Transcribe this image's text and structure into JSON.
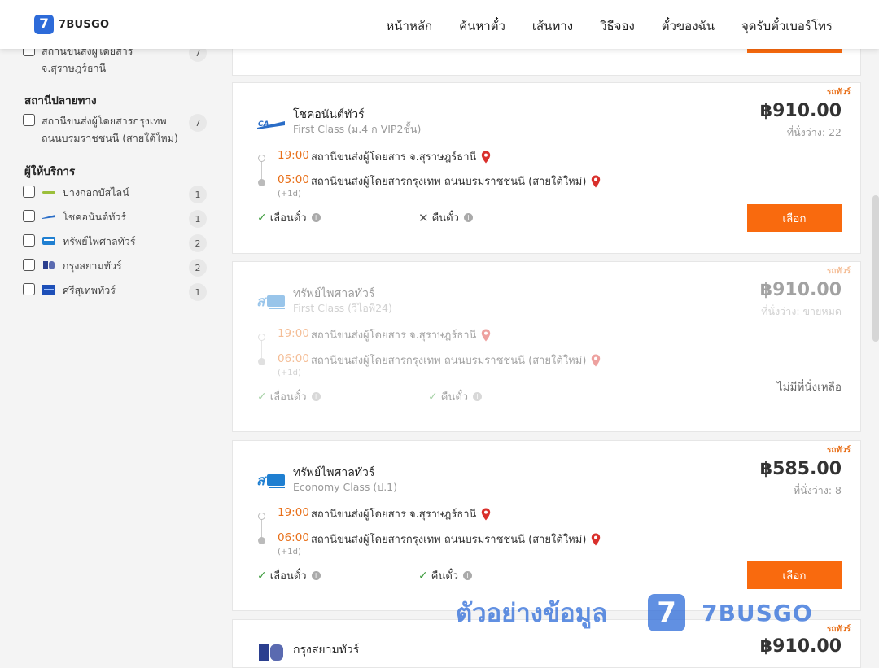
{
  "header": {
    "logo_mark": "7",
    "logo_text": "7BUSGO",
    "nav": [
      "หน้าหลัก",
      "ค้นหาตั๋ว",
      "เส้นทาง",
      "วิธีจอง",
      "ตั๋วของฉัน",
      "จุดรับตั๋วเบอร์โทร"
    ]
  },
  "sidebar": {
    "origin_item": {
      "label": "สถานีขนส่งผู้โดยสาร จ.สุราษฎร์ธานี",
      "count": "7"
    },
    "dest_title": "สถานีปลายทาง",
    "dest_item": {
      "label": "สถานีขนส่งผู้โดยสารกรุงเทพ ถนนบรมราชชนนี (สายใต้ใหม่)",
      "count": "7"
    },
    "provider_title": "ผู้ให้บริการ",
    "providers": [
      {
        "label": "บางกอกบัสไลน์",
        "count": "1",
        "color": "#9bbf3a"
      },
      {
        "label": "โชคอนันต์ทัวร์",
        "count": "1",
        "color": "#2a6dc7"
      },
      {
        "label": "ทรัพย์ไพศาลทัวร์",
        "count": "2",
        "color": "#1f7fd1"
      },
      {
        "label": "กรุงสยามทัวร์",
        "count": "2",
        "color": "#2b3f8f"
      },
      {
        "label": "ศรีสุเทพทัวร์",
        "count": "1",
        "color": "#1d4fb8"
      }
    ]
  },
  "trips": [
    {
      "tag": "รถทัวร์",
      "operator": "โชคอนันต์ทัวร์",
      "class": "First Class (ม.4 ก VIP2ชั้น)",
      "price": "฿910.00",
      "seats": "ที่นั่งว่าง: 22",
      "dep_time": "19:00",
      "dep_station": "สถานีขนส่งผู้โดยสาร จ.สุราษฎร์ธานี",
      "arr_time": "05:00",
      "arr_station": "สถานีขนส่งผู้โดยสารกรุงเทพ ถนนบรมราชชนนี (สายใต้ใหม่)",
      "plus_day": "(+1d)",
      "policy_change": "เลื่อนตั๋ว",
      "policy_refund": "คืนตั๋ว",
      "refund_ok": false,
      "button": "เลือก"
    },
    {
      "tag": "รถทัวร์",
      "operator": "ทรัพย์ไพศาลทัวร์",
      "class": "First Class (วีไอพี24)",
      "price": "฿910.00",
      "seats": "ที่นั่งว่าง: ขายหมด",
      "dep_time": "19:00",
      "dep_station": "สถานีขนส่งผู้โดยสาร จ.สุราษฎร์ธานี",
      "arr_time": "06:00",
      "arr_station": "สถานีขนส่งผู้โดยสารกรุงเทพ ถนนบรมราชชนนี (สายใต้ใหม่)",
      "plus_day": "(+1d)",
      "policy_change": "เลื่อนตั๋ว",
      "policy_refund": "คืนตั๋ว",
      "refund_ok": true,
      "sold_out": "ไม่มีที่นั่งเหลือ"
    },
    {
      "tag": "รถทัวร์",
      "operator": "ทรัพย์ไพศาลทัวร์",
      "class": "Economy Class (ป.1)",
      "price": "฿585.00",
      "seats": "ที่นั่งว่าง: 8",
      "dep_time": "19:00",
      "dep_station": "สถานีขนส่งผู้โดยสาร จ.สุราษฎร์ธานี",
      "arr_time": "06:00",
      "arr_station": "สถานีขนส่งผู้โดยสารกรุงเทพ ถนนบรมราชชนนี (สายใต้ใหม่)",
      "plus_day": "(+1d)",
      "policy_change": "เลื่อนตั๋ว",
      "policy_refund": "คืนตั๋ว",
      "refund_ok": true,
      "button": "เลือก"
    },
    {
      "tag": "รถทัวร์",
      "operator": "กรุงสยามทัวร์",
      "price": "฿910.00"
    }
  ],
  "watermark": {
    "text": "ตัวอย่างข้อมูล",
    "logo": "7",
    "brand": "7BUSGO"
  },
  "colors": {
    "accent": "#f96a0e",
    "brand": "#2d6bd9",
    "time": "#e8701a",
    "pin": "#d9302c"
  }
}
